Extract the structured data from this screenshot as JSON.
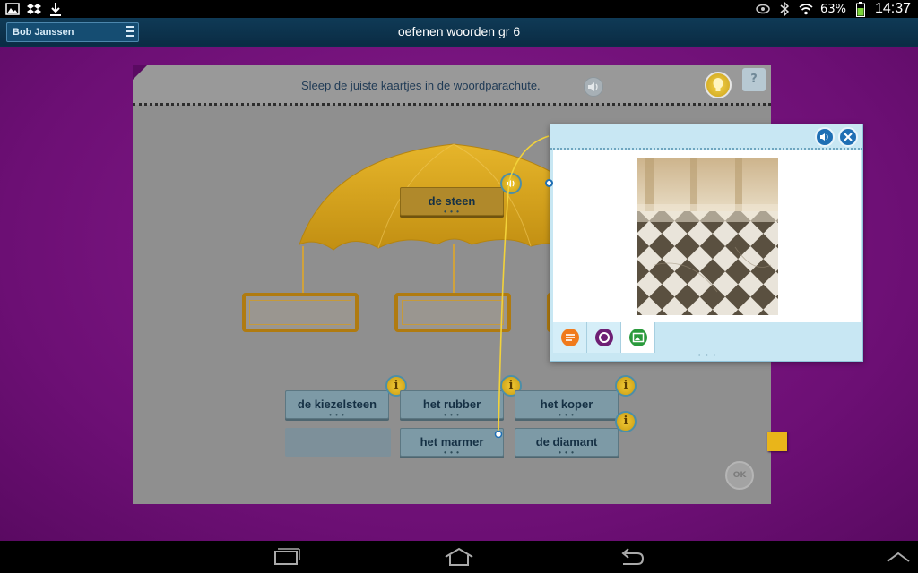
{
  "status_bar": {
    "battery": "63%",
    "time": "14:37"
  },
  "header": {
    "user_name": "Bob Janssen",
    "title": "oefenen woorden gr 6"
  },
  "exercise": {
    "instruction": "Sleep de juiste kaartjes in de woordparachute.",
    "target_word": "de steen",
    "word_cards": [
      {
        "label": "de kiezelsteen"
      },
      {
        "label": "het rubber"
      },
      {
        "label": "het koper"
      },
      {
        "label": "het marmer"
      },
      {
        "label": "de diamant"
      }
    ],
    "ok_label": "OK",
    "help_label": "?"
  },
  "colors": {
    "stage_purple": "#6c0f74",
    "header_blue": "#0f3a56",
    "parachute_gold": "#d9a51e",
    "card_blue": "#7d9aa6",
    "popup_blue": "#c8e7f3"
  }
}
